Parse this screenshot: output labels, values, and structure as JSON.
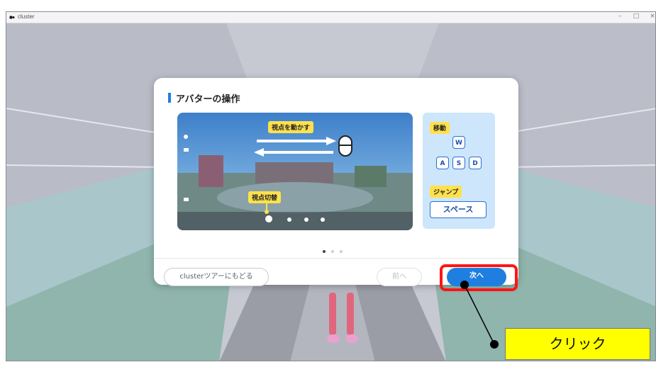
{
  "window": {
    "app_title": "cluster",
    "minimize": "–",
    "maximize": "□",
    "close": "×"
  },
  "modal": {
    "title": "アバターの操作",
    "preview": {
      "look_label": "視点を動かす",
      "switch_label": "視点切替"
    },
    "keys": {
      "move_label": "移動",
      "w": "W",
      "a": "A",
      "s": "S",
      "d": "D",
      "jump_label": "ジャンプ",
      "space": "スペース"
    },
    "page_indicator": {
      "total": 3,
      "current": 1
    },
    "buttons": {
      "tour": "clusterツアーにもどる",
      "prev": "前へ",
      "next": "次へ"
    }
  },
  "annotation": {
    "callout": "クリック"
  },
  "colors": {
    "accent": "#1f7fe0",
    "highlight": "#ff1414",
    "callout": "#ffff00",
    "tag": "#ffe14d"
  }
}
